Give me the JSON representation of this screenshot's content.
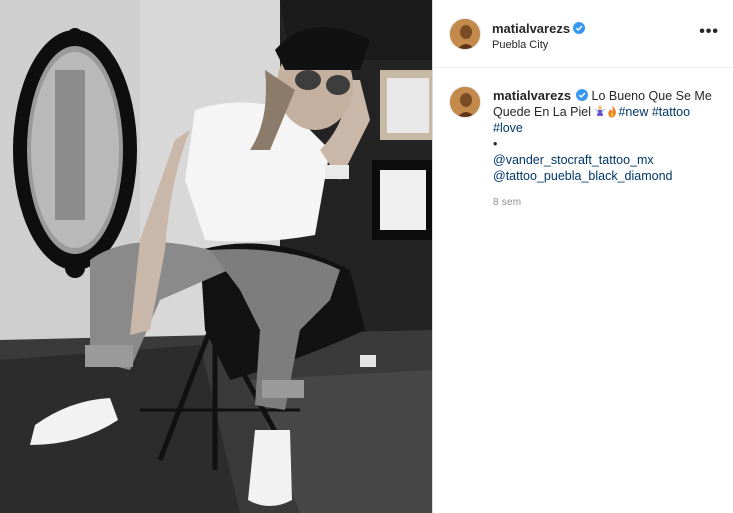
{
  "post": {
    "username": "matialvarezs",
    "location": "Puebla City",
    "more_icon": "•••",
    "caption_text": "Lo Bueno Que Se Me Quede En La Piel",
    "hashtags": [
      "#new",
      "#tattoo",
      "#love"
    ],
    "bullet": "•",
    "mentions": [
      "@vander_stocraft_tattoo_mx",
      "@tattoo_puebla_black_diamond"
    ],
    "timestamp": "8 sem"
  },
  "icons": {
    "verified": "verified-badge-icon",
    "more": "more-options-icon",
    "emoji_1": "fairy-emoji",
    "emoji_2": "fire-emoji"
  },
  "colors": {
    "link": "#00376b",
    "verified": "#3897f0",
    "text": "#262626",
    "muted": "#8e8e8e"
  }
}
